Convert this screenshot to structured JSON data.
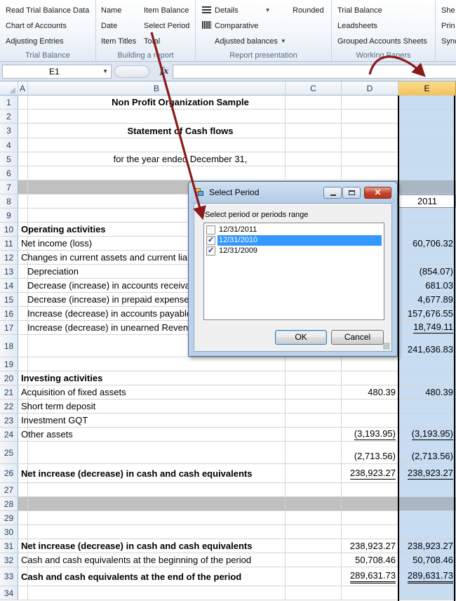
{
  "ribbon": {
    "groups": [
      {
        "label": "Trial Balance",
        "items": [
          "Read Trial Balance Data",
          "Chart of Accounts",
          "Adjusting Entries"
        ]
      },
      {
        "label": "Building a report",
        "items_left": [
          "Name",
          "Date",
          "Item Titles"
        ],
        "items_right": [
          "Item Balance",
          "Select Period",
          "Total"
        ]
      },
      {
        "label": "Report presentation",
        "items": [
          "Details",
          "Comparative",
          "Adjusted balances"
        ],
        "extra": "Rounded"
      },
      {
        "label": "Working Papers",
        "items": [
          "Trial Balance",
          "Leadsheets",
          "Grouped Accounts Sheets"
        ]
      },
      {
        "label": "",
        "items": [
          "She",
          "Prin",
          "Sync"
        ]
      }
    ]
  },
  "formula_bar": {
    "name_box": "E1",
    "fx_label": "fx",
    "formula": ""
  },
  "grid": {
    "columns": [
      "A",
      "B",
      "C",
      "D",
      "E"
    ],
    "selected_column": "E",
    "rows": [
      {
        "n": "1",
        "b": "Non Profit Organization Sample",
        "b_style": "center bold"
      },
      {
        "n": "2"
      },
      {
        "n": "3",
        "b": "Statement of Cash flows",
        "b_style": "center bold"
      },
      {
        "n": "4"
      },
      {
        "n": "5",
        "b": "for the year ended December 31,",
        "b_style": "center"
      },
      {
        "n": "6"
      },
      {
        "n": "7",
        "gray": true
      },
      {
        "n": "8",
        "e": "2011"
      },
      {
        "n": "9"
      },
      {
        "n": "10",
        "b": "Operating activities",
        "b_style": "bold"
      },
      {
        "n": "11",
        "b": "Net income (loss)",
        "e": "60,706.32"
      },
      {
        "n": "12",
        "b": "Changes in current assets and current liabilities"
      },
      {
        "n": "13",
        "b": "Depreciation",
        "b_style": "indent",
        "e": "(854.07)"
      },
      {
        "n": "14",
        "b": "Decrease (increase) in accounts receivable",
        "b_style": "indent",
        "e": "681.03"
      },
      {
        "n": "15",
        "b": "Decrease (increase) in prepaid expenses",
        "b_style": "indent",
        "e": "4,677.89"
      },
      {
        "n": "16",
        "b": "Increase (decrease) in accounts payable",
        "b_style": "indent",
        "e": "157,676.55"
      },
      {
        "n": "17",
        "b": "Increase (decrease) in unearned Revenue",
        "b_style": "indent",
        "e": "18,749.11"
      },
      {
        "n": "18",
        "e": "241,636.83"
      },
      {
        "n": "19"
      },
      {
        "n": "20",
        "b": "Investing activities",
        "b_style": "bold"
      },
      {
        "n": "21",
        "b": "Acquisition of fixed assets",
        "d": "480.39",
        "e": "480.39"
      },
      {
        "n": "22",
        "b": "Short term deposit"
      },
      {
        "n": "23",
        "b": "Investment GQT"
      },
      {
        "n": "24",
        "b": "Other assets",
        "d": "(3,193.95)",
        "e": "(3,193.95)"
      },
      {
        "n": "25",
        "d": "(2,713.56)",
        "e": "(2,713.56)"
      },
      {
        "n": "26",
        "b": "Net increase (decrease) in cash and cash equivalents",
        "b_style": "bold",
        "d": "238,923.27",
        "e": "238,923.27"
      },
      {
        "n": "27"
      },
      {
        "n": "28",
        "gray": true
      },
      {
        "n": "29"
      },
      {
        "n": "30"
      },
      {
        "n": "31",
        "b": "Net increase (decrease) in cash and cash equivalents",
        "b_style": "bold",
        "d": "238,923.27",
        "e": "238,923.27"
      },
      {
        "n": "32",
        "b": "Cash and cash equivalents at the beginning of the period",
        "d": "50,708.46",
        "e": "50,708.46"
      },
      {
        "n": "33",
        "b": "Cash and cash equivalents at the end of the period",
        "b_style": "bold",
        "d": "289,631.73",
        "e": "289,631.73"
      },
      {
        "n": "34"
      }
    ]
  },
  "dialog": {
    "title": "Select Period",
    "prompt": "Select period or periods range",
    "periods": [
      {
        "label": "12/31/2011",
        "checked": false,
        "selected": false
      },
      {
        "label": "12/31/2010",
        "checked": true,
        "selected": true
      },
      {
        "label": "12/31/2009",
        "checked": true,
        "selected": false
      }
    ],
    "ok_label": "OK",
    "cancel_label": "Cancel",
    "close_glyph": "✕"
  },
  "colors": {
    "annotation_arrow": "#8b1a1a",
    "selected_column_fill": "#c8ddf2",
    "list_selection": "#3399ff"
  }
}
